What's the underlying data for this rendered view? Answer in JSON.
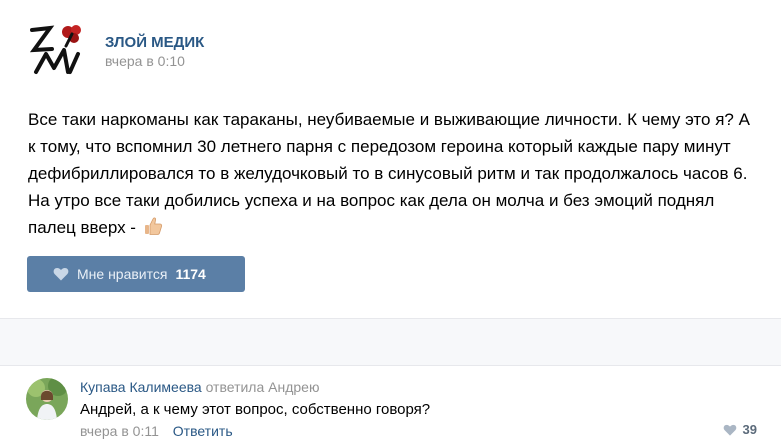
{
  "post": {
    "author": "ЗЛОЙ МЕДИК",
    "time": "вчера в 0:10",
    "text_main": "Все таки наркоманы как тараканы, неубиваемые и выживающие личности. К чему это я? А к тому, что вспомнил 30 летнего парня с передозом героина который каждые пару минут дефибриллировался то в желудочковый то в синусовый ритм и так продолжалось часов 6. На утро все таки добились успеха и на вопрос как дела он молча и без эмоций поднял палец вверх - ",
    "emoji_icon": "thumbs-up-icon",
    "like_label": "Мне нравится",
    "like_count": "1174"
  },
  "comment": {
    "author": "Купава Калимеева",
    "reply_to": "ответила Андрею",
    "text": "Андрей, а к чему этот вопрос, собственно говоря?",
    "time": "вчера в 0:11",
    "reply_link": "Ответить",
    "likes": "39"
  },
  "colors": {
    "link": "#2a5885",
    "muted": "#939393",
    "like_button": "#5b7fa6"
  }
}
